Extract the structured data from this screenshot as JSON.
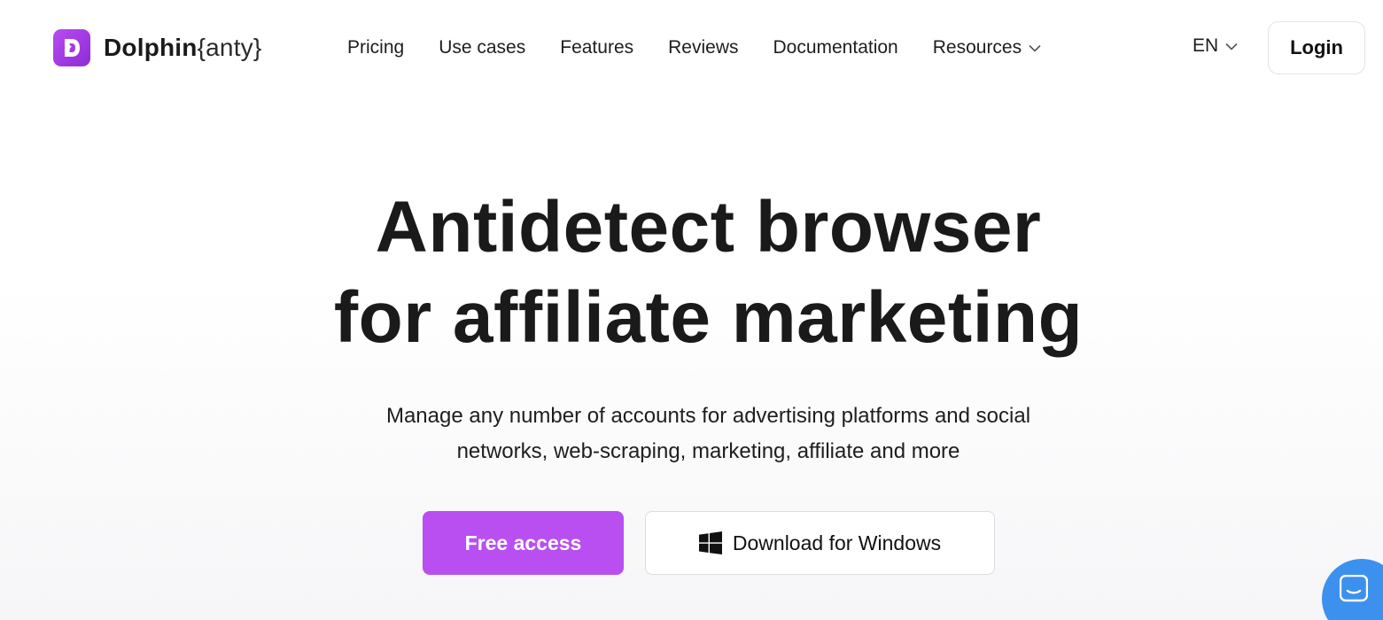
{
  "header": {
    "logo": {
      "brand_bold": "Dolphin",
      "brand_light": "{anty}"
    },
    "nav": [
      {
        "label": "Pricing"
      },
      {
        "label": "Use cases"
      },
      {
        "label": "Features"
      },
      {
        "label": "Reviews"
      },
      {
        "label": "Documentation"
      },
      {
        "label": "Resources",
        "has_dropdown": true
      }
    ],
    "language": {
      "label": "EN",
      "icon": "chevron-down-icon"
    },
    "login_label": "Login"
  },
  "hero": {
    "title_line1": "Antidetect browser",
    "title_line2": "for affiliate marketing",
    "subtitle_line1": "Manage any number of accounts for advertising platforms and social",
    "subtitle_line2": "networks, web-scraping, marketing, affiliate and more",
    "primary_cta": "Free access",
    "secondary_cta": "Download for Windows",
    "secondary_cta_icon": "windows-icon"
  },
  "chat_widget": {
    "icon": "chat-icon"
  },
  "colors": {
    "brand": "#b94ff0",
    "chat": "#3c91ee",
    "text": "#1a1a1a"
  }
}
